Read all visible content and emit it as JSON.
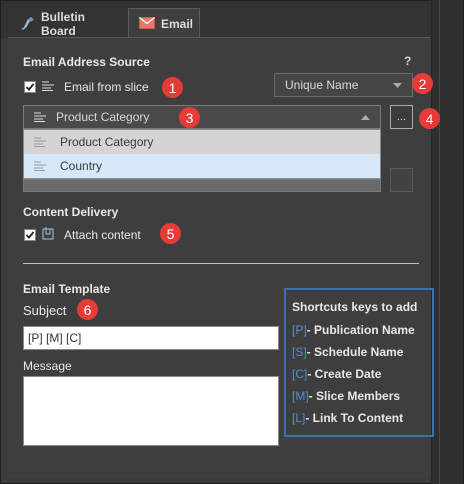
{
  "tabs": [
    {
      "label": "Bulletin Board",
      "icon": "bulletin-board-icon"
    },
    {
      "label": "Email",
      "icon": "envelope-icon",
      "active": true
    }
  ],
  "email_source": {
    "title": "Email Address Source",
    "help": "?",
    "from_slice_label": "Email from slice",
    "from_slice_checked": true,
    "name_dropdown": "Unique Name",
    "column_dropdown": "Product Category",
    "more_button": "...",
    "options": [
      "Product Category",
      "Country"
    ],
    "highlighted_option": "Country"
  },
  "content_delivery": {
    "title": "Content Delivery",
    "attach_label": "Attach content",
    "attach_checked": true
  },
  "email_template": {
    "title": "Email Template",
    "subject_label": "Subject",
    "subject_value": "[P] [M] [C]",
    "message_label": "Message",
    "message_value": ""
  },
  "shortcuts": {
    "title": "Shortcuts keys to add",
    "items": [
      {
        "key": "[P]",
        "label": "- Publication Name"
      },
      {
        "key": "[S]",
        "label": "- Schedule Name"
      },
      {
        "key": "[C]",
        "label": "- Create Date"
      },
      {
        "key": "[M]",
        "label": "- Slice Members"
      },
      {
        "key": "[L]",
        "label": "- Link To Content"
      }
    ]
  },
  "badges": [
    "1",
    "2",
    "3",
    "4",
    "5",
    "6"
  ],
  "colors": {
    "badge": "#e63b36",
    "shortcut_border": "#3f6fb3",
    "shortcut_key": "#4e8fd6",
    "highlight_row": "#d6e8f7"
  }
}
